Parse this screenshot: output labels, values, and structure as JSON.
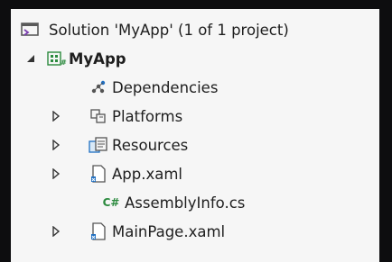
{
  "solution_explorer": {
    "solution": {
      "label": "Solution 'MyApp' (1 of 1 project)",
      "icon": "solution-icon"
    },
    "project": {
      "label": "MyApp",
      "icon": "csharp-project-icon",
      "expanded": true
    },
    "items": [
      {
        "label": "Dependencies",
        "icon": "dependencies-icon",
        "expandable": false
      },
      {
        "label": "Platforms",
        "icon": "platforms-folder-icon",
        "expandable": true
      },
      {
        "label": "Resources",
        "icon": "resources-folder-icon",
        "expandable": true
      },
      {
        "label": "App.xaml",
        "icon": "xaml-file-icon",
        "expandable": true
      },
      {
        "label": "AssemblyInfo.cs",
        "icon": "csharp-file-icon",
        "glyph": "C#",
        "expandable": false
      },
      {
        "label": "MainPage.xaml",
        "icon": "xaml-file-icon",
        "expandable": true
      }
    ]
  },
  "colors": {
    "background": "#f6f6f6",
    "frame": "#0d0d0f",
    "text": "#1e1e1e",
    "xaml_blue": "#1f6fc2",
    "project_green": "#2b8a3e"
  }
}
